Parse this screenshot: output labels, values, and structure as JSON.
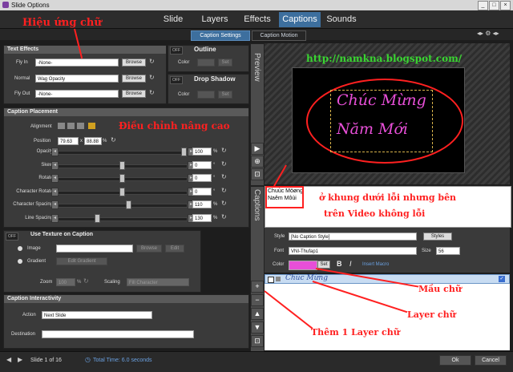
{
  "window": {
    "title": "Slide Options"
  },
  "topnav": {
    "tabs": [
      "Slide",
      "Layers",
      "Effects",
      "Captions",
      "Sounds"
    ],
    "active": "Captions"
  },
  "subtabs": {
    "items": [
      "Caption Settings",
      "Caption Motion"
    ],
    "active": "Caption Settings"
  },
  "text_effects": {
    "header": "Text Effects",
    "fly_in_label": "Fly In",
    "fly_in_value": "-None-",
    "normal_label": "Normal",
    "normal_value": "Wag Opacity",
    "fly_out_label": "Fly Out",
    "fly_out_value": "-None-",
    "browse": "Browse"
  },
  "outline": {
    "toggle": "OFF",
    "header": "Outline",
    "color_label": "Color",
    "set": "Set"
  },
  "drop_shadow": {
    "toggle": "OFF",
    "header": "Drop Shadow",
    "color_label": "Color",
    "set": "Set"
  },
  "placement": {
    "header": "Caption Placement",
    "alignment_label": "Alignment",
    "position_label": "Position",
    "pos_x": "79.63",
    "pos_sep": "x",
    "pos_y": "88.88",
    "pos_unit": "%",
    "rows": [
      {
        "label": "Opacity",
        "value": "100",
        "unit": "%",
        "level": 1.0
      },
      {
        "label": "Skew",
        "value": "0",
        "unit": "°",
        "level": 0.5
      },
      {
        "label": "Rotate",
        "value": "0",
        "unit": "°",
        "level": 0.5
      },
      {
        "label": "Character Rotate",
        "value": "0",
        "unit": "°",
        "level": 0.5
      },
      {
        "label": "Character Spacing",
        "value": "110",
        "unit": "%",
        "level": 0.55
      },
      {
        "label": "Line Spacing",
        "value": "130",
        "unit": "%",
        "level": 0.3
      }
    ]
  },
  "texture": {
    "toggle": "OFF",
    "header": "Use Texture on Caption",
    "image_label": "Image",
    "gradient_label": "Gradient",
    "browse": "Browse",
    "edit": "Edit",
    "edit_gradient": "Edit Gradient",
    "zoom_label": "Zoom",
    "zoom_value": "100",
    "zoom_unit": "%",
    "scaling_label": "Scaling",
    "scaling_value": "Fill Character"
  },
  "interactivity": {
    "header": "Caption Interactivity",
    "action_label": "Action",
    "action_value": "Next Slide",
    "destination_label": "Destination"
  },
  "preview": {
    "side_label": "Preview",
    "url": "http://namkna.blogspot.com/",
    "caption_line1": "Chúc Mừng",
    "caption_line2": "Năm Mới"
  },
  "captions_panel": {
    "side_label": "Captions",
    "text_line1": "Chuùc Möøng",
    "text_line2": "Naêm Môùi",
    "style_label": "Style",
    "style_value": "[No Caption Style]",
    "styles_btn": "Styles",
    "font_label": "Font",
    "font_value": "VNI-Thufap1",
    "size_label": "Size",
    "size_value": "56",
    "color_label": "Color",
    "color_set": "Set",
    "bold": "B",
    "italic": "I",
    "insert_macro": "Insert Macro",
    "color_swatch": "#e84fd8",
    "layer_text": "Chúc Mừng"
  },
  "annotations": {
    "hieu_ung": "Hiệu ứng chữ",
    "dieu_chinh": "Điều chỉnh nâng cao",
    "o_khung_1": "ở khung dưới lỗi nhưng bên",
    "o_khung_2": "trên Video không lỗi",
    "mau_chu": "Mầu chữ",
    "layer_chu": "Layer chữ",
    "them_layer": "Thêm 1 Layer chữ"
  },
  "footer": {
    "slide": "Slide 1 of 16",
    "total_time": "Total Time: 6.0 seconds",
    "ok": "Ok",
    "cancel": "Cancel"
  },
  "colors": {
    "accent": "#3d6f9e",
    "annotation_red": "#ff2020",
    "url_green": "#39d631",
    "caption_magenta": "#e84fd8"
  }
}
